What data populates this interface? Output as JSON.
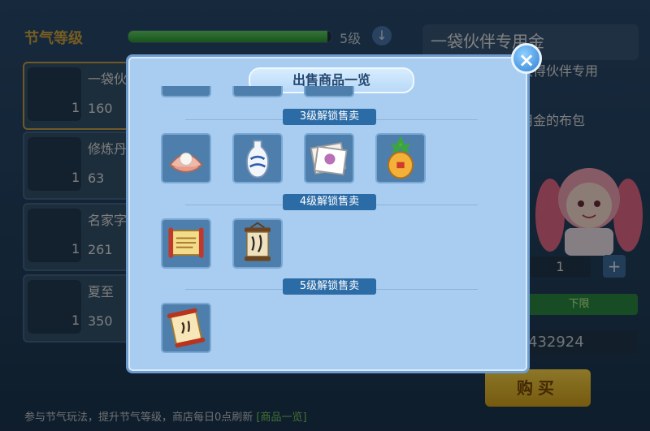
{
  "shop": {
    "level_title": "节气等级",
    "level_text": "5级",
    "level_progress": 0.98,
    "items": [
      {
        "name": "一袋伙",
        "count": "1",
        "price": "160"
      },
      {
        "name": "修炼丹",
        "count": "1",
        "price": "63"
      },
      {
        "name": "名家字",
        "count": "1",
        "price": "261"
      },
      {
        "name": "夏至",
        "count": "1",
        "price": "350"
      }
    ],
    "detail_title": "一袋伙伴专用金",
    "detail_desc": "获得伙伴专用",
    "detail_desc2": "用金的布包",
    "quantity": "1",
    "plus_label": "+",
    "green_bar_text": "下限",
    "money": "432924",
    "buy_label": "购买",
    "bottom_tip": "参与节气玩法，提升节气等级，商店每日0点刷新",
    "bottom_link": "[商品一览]"
  },
  "modal": {
    "title": "出售商品一览",
    "close_label": "×",
    "sections": [
      {
        "label": "3级解锁售卖",
        "items": [
          "pearl-shell-icon",
          "blue-vase-icon",
          "painting-scroll-icon",
          "pineapple-pouch-icon"
        ]
      },
      {
        "label": "4级解锁售卖",
        "items": [
          "open-scroll-icon",
          "hanging-calligraphy-icon"
        ]
      },
      {
        "label": "5级解锁售卖",
        "items": [
          "solar-term-scroll-icon"
        ]
      }
    ]
  },
  "colors": {
    "accent_gold": "#d7a93e",
    "modal_bg": "#a9cdf0",
    "section_label": "#2b6ba6",
    "buy_button": "#ffd84a"
  }
}
